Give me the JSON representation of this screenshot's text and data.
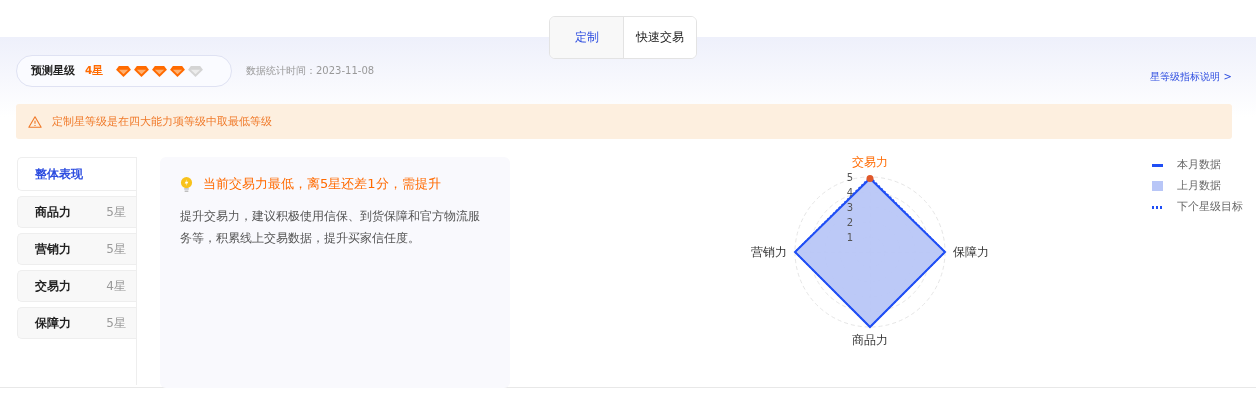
{
  "tabs": [
    {
      "label": "定制",
      "selected": true
    },
    {
      "label": "快速交易",
      "selected": false
    }
  ],
  "rating": {
    "label": "预测星级",
    "value": "4星",
    "stars": 4
  },
  "stats_time": "数据统计时间：2023-11-08",
  "help_link": "星等级指标说明 >",
  "alert": "定制星等级是在四大能力项等级中取最低等级",
  "menu": [
    {
      "label": "整体表现",
      "selected": true
    },
    {
      "label": "商品力",
      "grade": "5星",
      "selected": false
    },
    {
      "label": "营销力",
      "grade": "5星",
      "selected": false
    },
    {
      "label": "交易力",
      "grade": "4星",
      "selected": false
    },
    {
      "label": "保障力",
      "grade": "5星",
      "selected": false
    }
  ],
  "tip": {
    "title": "当前交易力最低，离5星还差1分，需提升",
    "text": "提升交易力，建议积极使用信保、到货保障和官方物流服务等，积累线上交易数据，提升买家信任度。"
  },
  "radar": {
    "axes": [
      {
        "label": "交易力",
        "highlighted": true
      },
      {
        "label": "保障力",
        "highlighted": false
      },
      {
        "label": "商品力",
        "highlighted": false
      },
      {
        "label": "营销力",
        "highlighted": false
      }
    ],
    "ticks": [
      "5",
      "4",
      "3",
      "2",
      "1"
    ],
    "legend": [
      {
        "label": "本月数据",
        "kind": "line",
        "color": "#1f4ef5"
      },
      {
        "label": "上月数据",
        "kind": "area",
        "color": "#b8c6f7"
      },
      {
        "label": "下个星级目标",
        "kind": "dotted",
        "color": "#1f4ef5"
      }
    ]
  }
}
